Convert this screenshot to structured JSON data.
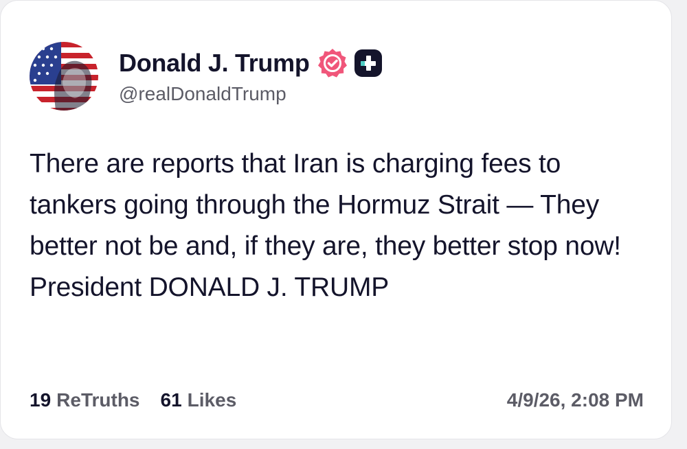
{
  "author": {
    "display_name": "Donald J. Trump",
    "handle": "@realDonaldTrump",
    "avatar_icon": "flag-portrait-avatar",
    "verified_icon": "verified-badge-icon",
    "plus_icon": "plus-badge-icon"
  },
  "post": {
    "text": "There are reports that Iran is charging fees to tankers going through the Hormuz Strait — They better not be and, if they are, they better stop now! President DONALD J. TRUMP"
  },
  "stats": {
    "retruths_count": "19",
    "retruths_label": "ReTruths",
    "likes_count": "61",
    "likes_label": "Likes"
  },
  "timestamp": "4/9/26, 2:08 PM",
  "colors": {
    "verified_badge": "#f0567a",
    "plus_badge": "#14142b",
    "plus_accent": "#4ecdc4",
    "text_primary": "#14142b",
    "text_secondary": "#5c5c66"
  }
}
